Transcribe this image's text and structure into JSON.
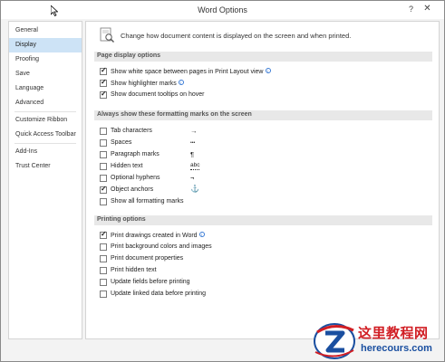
{
  "window": {
    "title": "Word Options",
    "help": "?",
    "close": "✕"
  },
  "sidebar": {
    "items": [
      {
        "label": "General"
      },
      {
        "label": "Display",
        "active": true
      },
      {
        "label": "Proofing"
      },
      {
        "label": "Save"
      },
      {
        "label": "Language"
      },
      {
        "label": "Advanced"
      },
      {
        "label": "Customize Ribbon"
      },
      {
        "label": "Quick Access Toolbar"
      },
      {
        "label": "Add-Ins"
      },
      {
        "label": "Trust Center"
      }
    ]
  },
  "main": {
    "header_text": "Change how document content is displayed on the screen and when printed.",
    "page_display": {
      "title": "Page display options",
      "options": [
        {
          "label": "Show white space between pages in Print Layout view",
          "checked": true,
          "info": true
        },
        {
          "label": "Show highlighter marks",
          "checked": true,
          "info": true
        },
        {
          "label": "Show document tooltips on hover",
          "checked": true,
          "info": false
        }
      ]
    },
    "formatting_marks": {
      "title": "Always show these formatting marks on the screen",
      "options": [
        {
          "label": "Tab characters",
          "checked": false,
          "glyph": "→"
        },
        {
          "label": "Spaces",
          "checked": false,
          "glyph": "•••"
        },
        {
          "label": "Paragraph marks",
          "checked": false,
          "glyph": "¶"
        },
        {
          "label": "Hidden text",
          "checked": false,
          "glyph": "abc"
        },
        {
          "label": "Optional hyphens",
          "checked": false,
          "glyph": "¬"
        },
        {
          "label": "Object anchors",
          "checked": true,
          "glyph": "⚓"
        },
        {
          "label": "Show all formatting marks",
          "checked": false,
          "glyph": ""
        }
      ]
    },
    "printing": {
      "title": "Printing options",
      "options": [
        {
          "label": "Print drawings created in Word",
          "checked": true,
          "info": true
        },
        {
          "label": "Print background colors and images",
          "checked": false,
          "info": false
        },
        {
          "label": "Print document properties",
          "checked": false,
          "info": false
        },
        {
          "label": "Print hidden text",
          "checked": false,
          "info": false
        },
        {
          "label": "Update fields before printing",
          "checked": false,
          "info": false
        },
        {
          "label": "Update linked data before printing",
          "checked": false,
          "info": false
        }
      ]
    }
  },
  "watermark": {
    "chinese": "这里教程网",
    "url": "herecours.com"
  },
  "colors": {
    "active_nav": "#cde3f6",
    "section_band": "#e8e8e8",
    "watermark_red": "#d11e24",
    "watermark_blue": "#1a4fa0"
  }
}
